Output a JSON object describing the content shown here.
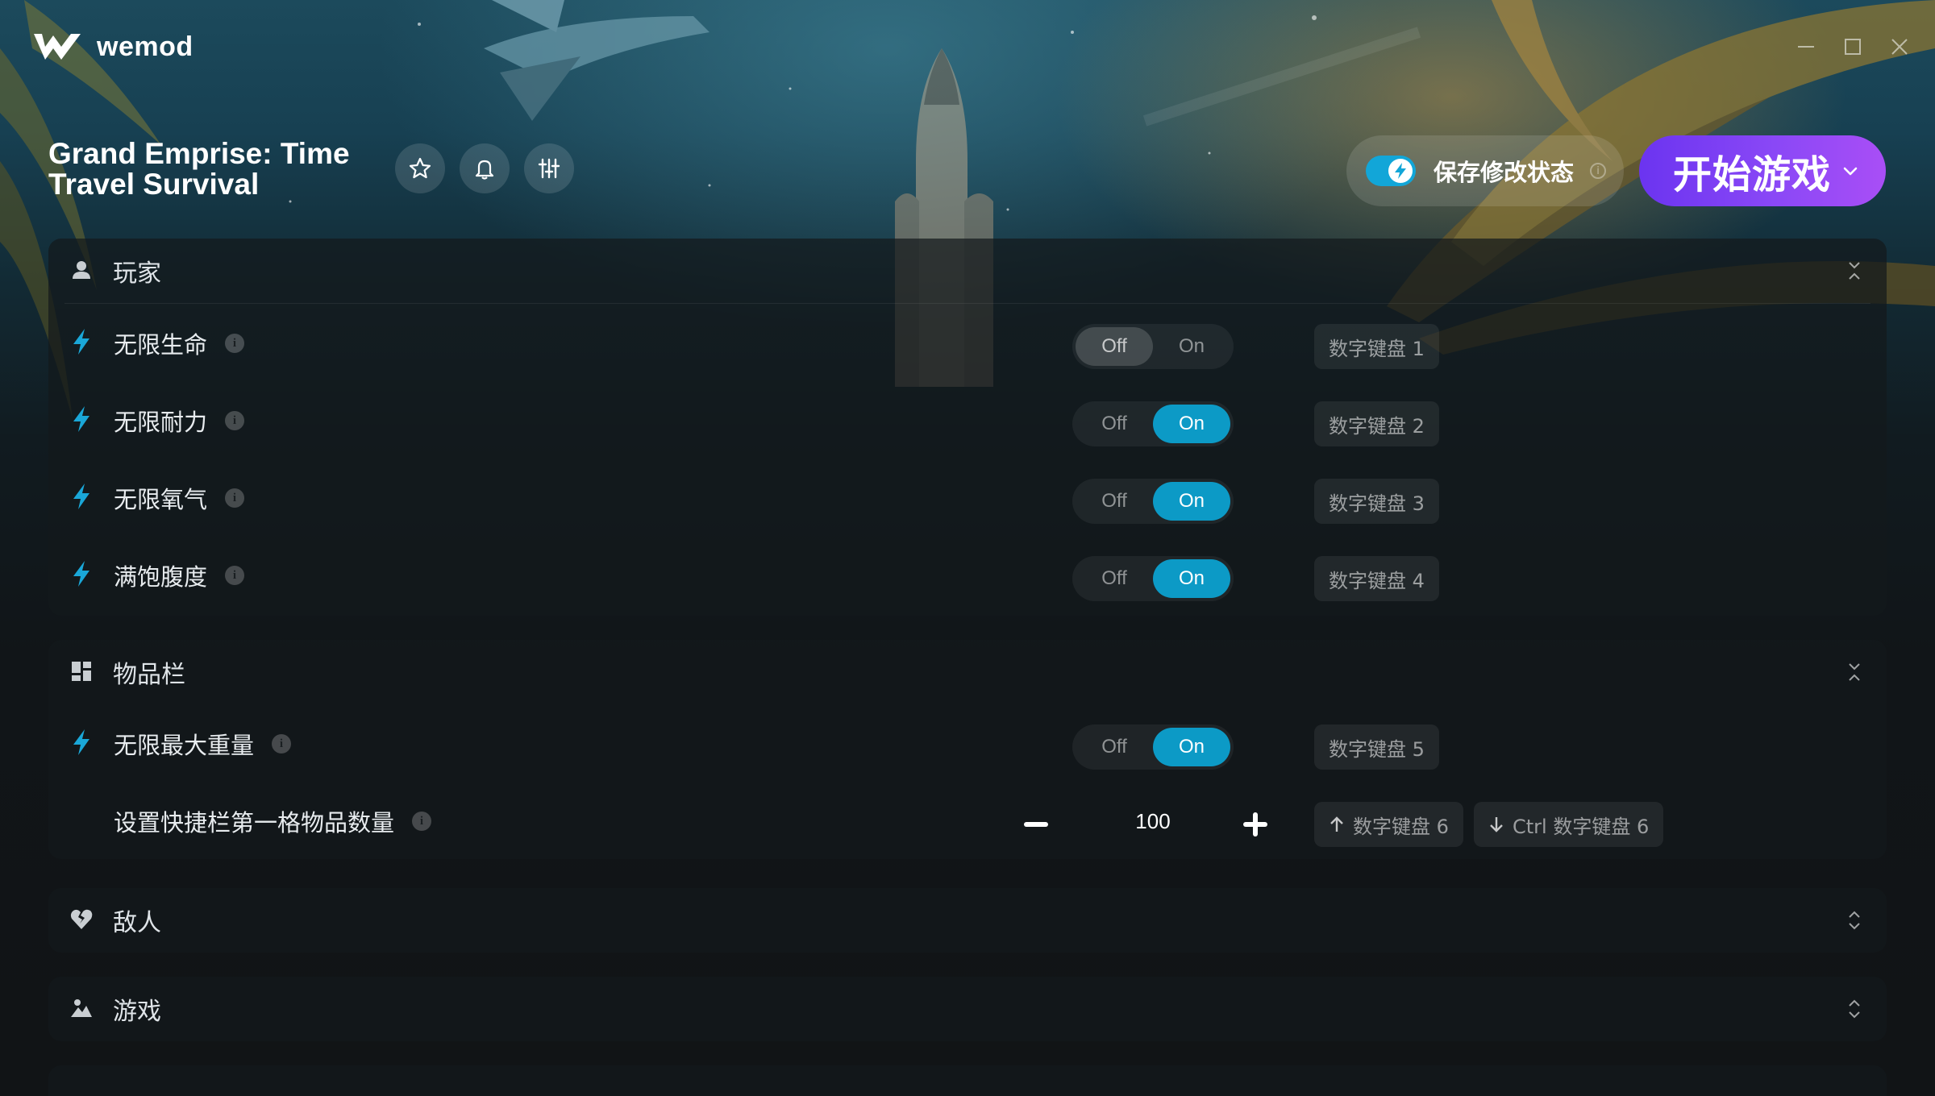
{
  "app": {
    "brand": "wemod"
  },
  "header": {
    "game_title": "Grand Emprise: Time Travel Survival",
    "icons": [
      "star-icon",
      "bell-icon",
      "sliders-icon"
    ],
    "save_mods_label": "保存修改状态",
    "save_mods_enabled": true,
    "save_info": "i",
    "play_label": "开始游戏"
  },
  "colors": {
    "accent": "#0c9ac6",
    "play_gradient_start": "#6b34f0",
    "play_gradient_end": "#a94ef6",
    "bolt": "#1aa7d8"
  },
  "categories": [
    {
      "label": "玩家",
      "icon": "user-icon",
      "mods": [
        {
          "label": "无限生命",
          "state": "Off",
          "hotkey": "数字键盘 1"
        },
        {
          "label": "无限耐力",
          "state": "On",
          "hotkey": "数字键盘 2"
        },
        {
          "label": "无限氧气",
          "state": "On",
          "hotkey": "数字键盘 3"
        },
        {
          "label": "满饱腹度",
          "state": "On",
          "hotkey": "数字键盘 4"
        }
      ]
    },
    {
      "label": "物品栏",
      "icon": "grid-icon",
      "mods": [
        {
          "label": "无限最大重量",
          "state": "On",
          "hotkey": "数字键盘 5"
        }
      ],
      "stepper": {
        "label": "设置快捷栏第一格物品数量",
        "value": "100",
        "hotkey_up": "数字键盘 6",
        "hotkey_down": "Ctrl 数字键盘 6"
      }
    },
    {
      "label": "敌人",
      "icon": "broken-heart-icon"
    },
    {
      "label": "游戏",
      "icon": "landscape-icon"
    }
  ],
  "toggle_labels": {
    "off": "Off",
    "on": "On"
  }
}
